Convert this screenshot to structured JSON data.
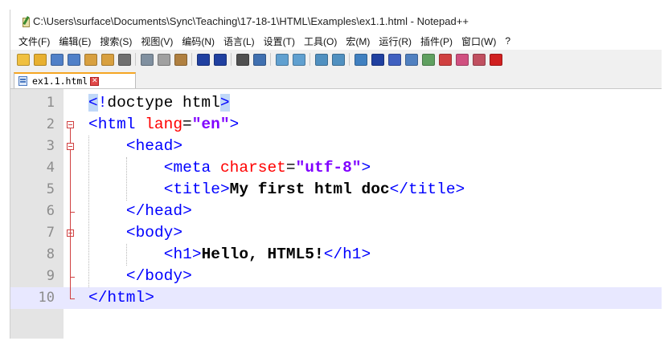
{
  "window": {
    "title": "C:\\Users\\surface\\Documents\\Sync\\Teaching\\17-18-1\\HTML\\Examples\\ex1.1.html - Notepad++"
  },
  "menu": [
    "文件(F)",
    "编辑(E)",
    "搜索(S)",
    "视图(V)",
    "编码(N)",
    "语言(L)",
    "设置(T)",
    "工具(O)",
    "宏(M)",
    "运行(R)",
    "插件(P)",
    "窗口(W)",
    "?"
  ],
  "toolbar_icons": [
    {
      "name": "new-file-icon",
      "color": "#f0c040"
    },
    {
      "name": "open-file-icon",
      "color": "#e8b030"
    },
    {
      "name": "save-icon",
      "color": "#5080c8"
    },
    {
      "name": "save-all-icon",
      "color": "#5080c8"
    },
    {
      "name": "close-icon",
      "color": "#d8a040"
    },
    {
      "name": "close-all-icon",
      "color": "#d8a040"
    },
    {
      "name": "print-icon",
      "color": "#707070"
    },
    {
      "name": "sep",
      "color": ""
    },
    {
      "name": "cut-icon",
      "color": "#8090a0"
    },
    {
      "name": "copy-icon",
      "color": "#a0a0a0"
    },
    {
      "name": "paste-icon",
      "color": "#b08040"
    },
    {
      "name": "sep",
      "color": ""
    },
    {
      "name": "undo-icon",
      "color": "#2040a0"
    },
    {
      "name": "redo-icon",
      "color": "#2040a0"
    },
    {
      "name": "sep",
      "color": ""
    },
    {
      "name": "find-icon",
      "color": "#505050"
    },
    {
      "name": "replace-icon",
      "color": "#4070b0"
    },
    {
      "name": "sep",
      "color": ""
    },
    {
      "name": "zoom-in-icon",
      "color": "#60a0d0"
    },
    {
      "name": "zoom-out-icon",
      "color": "#60a0d0"
    },
    {
      "name": "sep",
      "color": ""
    },
    {
      "name": "sync-vertical-icon",
      "color": "#5090c0"
    },
    {
      "name": "sync-horizontal-icon",
      "color": "#5090c0"
    },
    {
      "name": "sep",
      "color": ""
    },
    {
      "name": "word-wrap-icon",
      "color": "#4080c0"
    },
    {
      "name": "show-all-chars-icon",
      "color": "#2040a0"
    },
    {
      "name": "indent-guide-icon",
      "color": "#4060c0"
    },
    {
      "name": "user-lang-icon",
      "color": "#5080c0"
    },
    {
      "name": "doc-map-icon",
      "color": "#60a060"
    },
    {
      "name": "function-list-icon",
      "color": "#d04040"
    },
    {
      "name": "folder-workspace-icon",
      "color": "#d05080"
    },
    {
      "name": "monitoring-icon",
      "color": "#c05060"
    },
    {
      "name": "record-macro-icon",
      "color": "#d02020"
    }
  ],
  "tab": {
    "label": "ex1.1.html"
  },
  "lines": [
    {
      "n": "1",
      "current": false,
      "indent": 0,
      "segs": [
        {
          "c": "tag hl",
          "t": "<"
        },
        {
          "c": "tag",
          "t": "!"
        },
        {
          "c": "plain",
          "t": "doctype html"
        },
        {
          "c": "tag hl",
          "t": ">"
        }
      ]
    },
    {
      "n": "2",
      "current": false,
      "indent": 0,
      "segs": [
        {
          "c": "tag",
          "t": "<html "
        },
        {
          "c": "attr",
          "t": "lang"
        },
        {
          "c": "plain",
          "t": "="
        },
        {
          "c": "val",
          "t": "\"en\""
        },
        {
          "c": "tag",
          "t": ">"
        }
      ]
    },
    {
      "n": "3",
      "current": false,
      "indent": 1,
      "segs": [
        {
          "c": "tag",
          "t": "<head>"
        }
      ]
    },
    {
      "n": "4",
      "current": false,
      "indent": 2,
      "segs": [
        {
          "c": "tag",
          "t": "<meta "
        },
        {
          "c": "attr",
          "t": "charset"
        },
        {
          "c": "plain",
          "t": "="
        },
        {
          "c": "val",
          "t": "\"utf-8\""
        },
        {
          "c": "tag",
          "t": ">"
        }
      ]
    },
    {
      "n": "5",
      "current": false,
      "indent": 2,
      "segs": [
        {
          "c": "tag",
          "t": "<title>"
        },
        {
          "c": "txt",
          "t": "My first html doc"
        },
        {
          "c": "tag",
          "t": "</title>"
        }
      ]
    },
    {
      "n": "6",
      "current": false,
      "indent": 1,
      "segs": [
        {
          "c": "tag",
          "t": "</head>"
        }
      ]
    },
    {
      "n": "7",
      "current": false,
      "indent": 1,
      "segs": [
        {
          "c": "tag",
          "t": "<body>"
        }
      ]
    },
    {
      "n": "8",
      "current": false,
      "indent": 2,
      "segs": [
        {
          "c": "tag",
          "t": "<h1>"
        },
        {
          "c": "txt",
          "t": "Hello, HTML5!"
        },
        {
          "c": "tag",
          "t": "</h1>"
        }
      ]
    },
    {
      "n": "9",
      "current": false,
      "indent": 1,
      "segs": [
        {
          "c": "tag",
          "t": "</body>"
        }
      ]
    },
    {
      "n": "10",
      "current": true,
      "indent": 0,
      "segs": [
        {
          "c": "tag",
          "t": "</html>"
        }
      ]
    }
  ]
}
